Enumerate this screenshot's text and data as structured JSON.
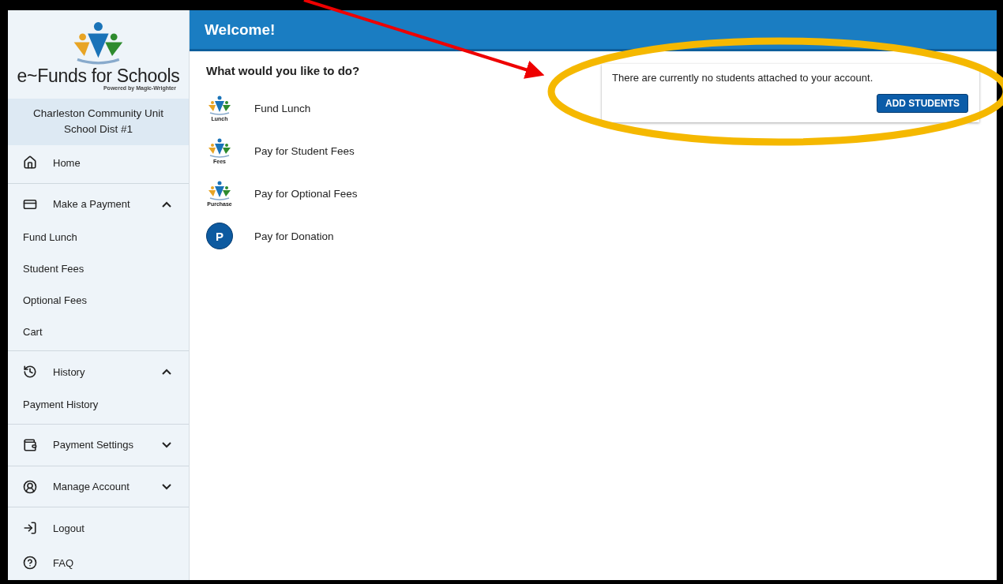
{
  "logo": {
    "title": "e~Funds for Schools",
    "tagline": "Powered by Magic-Wrighter"
  },
  "district": "Charleston Community Unit School Dist #1",
  "nav": [
    {
      "kind": "item",
      "label": "Home"
    },
    {
      "kind": "group",
      "label": "Make a Payment",
      "expanded": true,
      "children": [
        "Fund Lunch",
        "Student Fees",
        "Optional Fees",
        "Cart"
      ]
    },
    {
      "kind": "group",
      "label": "History",
      "expanded": true,
      "children": [
        "Payment History"
      ]
    },
    {
      "kind": "group",
      "label": "Payment Settings",
      "expanded": false
    },
    {
      "kind": "group",
      "label": "Manage Account",
      "expanded": false
    },
    {
      "kind": "item",
      "label": "Logout"
    },
    {
      "kind": "item",
      "label": "FAQ"
    }
  ],
  "header": {
    "title": "Welcome!"
  },
  "prompt": "What would you like to do?",
  "actions": [
    {
      "kind": "logo",
      "badge": "Lunch",
      "label": "Fund Lunch"
    },
    {
      "kind": "logo",
      "badge": "Fees",
      "label": "Pay for Student Fees"
    },
    {
      "kind": "logo",
      "badge": "Purchase",
      "label": "Pay for Optional Fees"
    },
    {
      "kind": "letter",
      "badge": "P",
      "label": "Pay for Donation"
    }
  ],
  "notice": {
    "message": "There are currently no students attached to your account.",
    "button": "ADD STUDENTS"
  }
}
